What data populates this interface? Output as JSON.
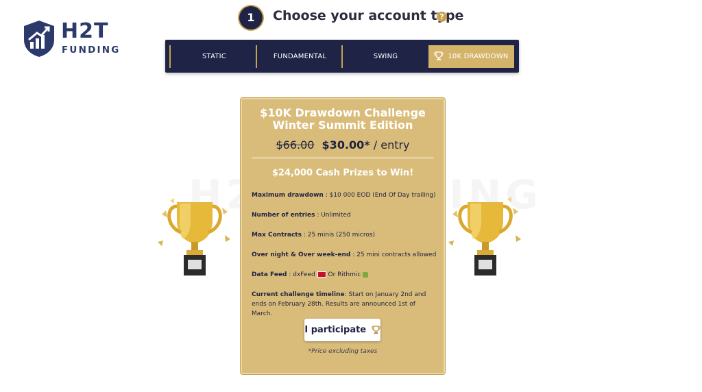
{
  "brand": {
    "name": "H2T",
    "subname": "FUNDING",
    "colors": {
      "navy": "#1f2447",
      "gold": "#d4b46a",
      "brand_blue": "#2c3a6b"
    }
  },
  "step": {
    "number": "1",
    "title": "Choose your account type",
    "help": "?"
  },
  "tabs": [
    {
      "label": "STATIC",
      "active": false
    },
    {
      "label": "FUNDAMENTAL",
      "active": false
    },
    {
      "label": "SWING",
      "active": false
    },
    {
      "label": "10K DRAWDOWN",
      "active": true,
      "icon": "trophy-icon"
    }
  ],
  "watermark": "H2T FUNDING",
  "card": {
    "title_line1": "$10K Drawdown Challenge",
    "title_line2": "Winter Summit Edition",
    "old_price": "$66.00",
    "new_price": "$30.00*",
    "price_suffix": " / entry",
    "prize": "$24,000 Cash Prizes to Win!",
    "features": [
      {
        "label": "Maximum drawdown",
        "value": " : $10 000 EOD (End Of Day trailing)"
      },
      {
        "label": "Number of entries",
        "value": " : Unlimited"
      },
      {
        "label": "Max Contracts",
        "value": " : 25 minis (250 micros)"
      },
      {
        "label": "Over night & Over week-end",
        "value": " : 25 mini contracts allowed"
      },
      {
        "label": "Data Feed",
        "value_a": " : dxFeed ",
        "value_b": " Or Rithmic "
      },
      {
        "label": "Current challenge timeline",
        "value": ": Start on January 2nd and ends on February 28th. Results are announced 1st of March."
      }
    ],
    "button_label": "I participate",
    "note": "*Price excluding taxes"
  }
}
